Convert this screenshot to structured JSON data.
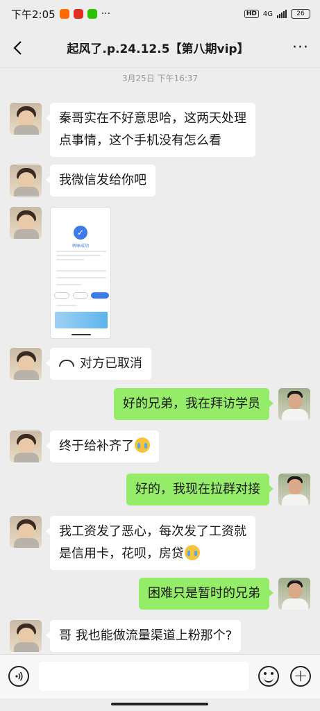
{
  "status_bar": {
    "time": "下午2:05",
    "more": "···",
    "hd": "HD",
    "network": "4G",
    "battery": "26"
  },
  "nav": {
    "title": "起风了.p.24.12.5【第八期vip】",
    "more": "···"
  },
  "chat": {
    "timestamp": "3月25日 下午16:37",
    "messages": [
      {
        "side": "left",
        "lines": [
          "秦哥实在不好意思哈，这两天处理",
          "点事情，这个手机没有怎么看"
        ]
      },
      {
        "side": "left",
        "text": "我微信发给你吧"
      },
      {
        "side": "left",
        "type": "image",
        "image_title": "转账成功"
      },
      {
        "side": "left",
        "text": "对方已取消",
        "icon": "call-declined-icon"
      },
      {
        "side": "right",
        "text": "好的兄弟，我在拜访学员"
      },
      {
        "side": "left",
        "text": "终于给补齐了",
        "emoji": "crying-emoji"
      },
      {
        "side": "right",
        "text": "好的，我现在拉群对接"
      },
      {
        "side": "left",
        "lines": [
          "我工资发了恶心，每次发了工资就",
          "是信用卡，花呗，房贷"
        ],
        "emoji": "crying-emoji"
      },
      {
        "side": "right",
        "text": "困难只是暂时的兄弟"
      },
      {
        "side": "left",
        "text": "哥 我也能做流量渠道上粉那个?"
      }
    ]
  },
  "input_bar": {
    "voice_icon": "voice-icon",
    "placeholder": "",
    "emoji_icon": "emoji-icon",
    "plus": "+"
  },
  "colors": {
    "background": "#ededed",
    "bubble_self": "#95ec69",
    "bubble_other": "#ffffff"
  }
}
